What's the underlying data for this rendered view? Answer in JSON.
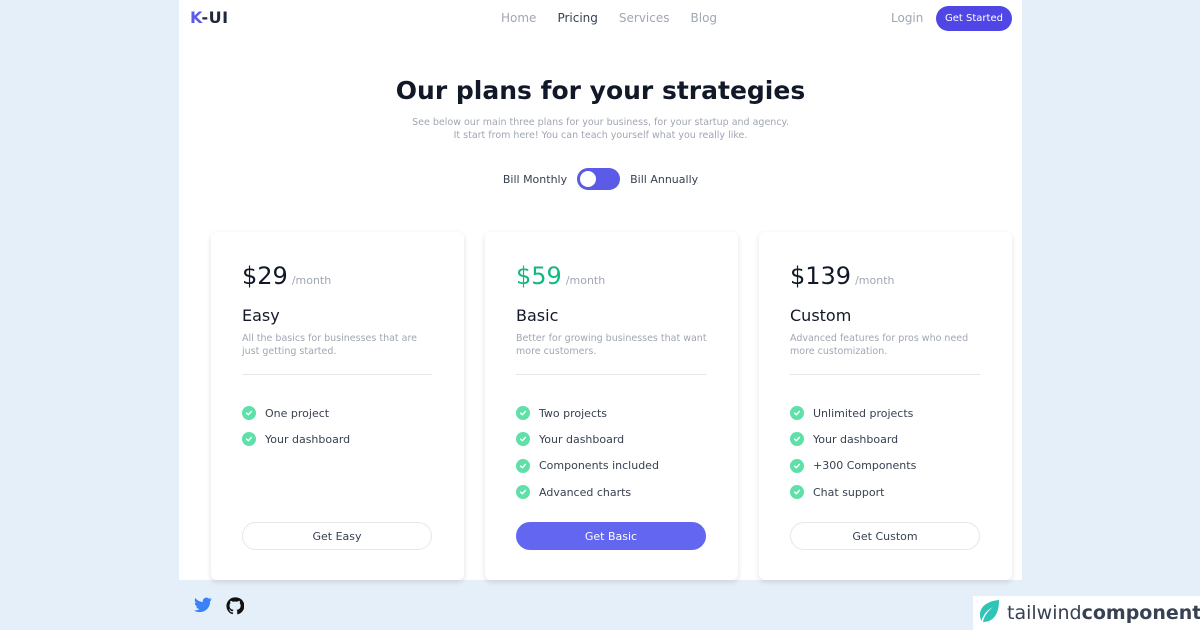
{
  "nav": {
    "logo_k": "K",
    "logo_rest": "-UI",
    "links": [
      {
        "label": "Home",
        "active": false
      },
      {
        "label": "Pricing",
        "active": true
      },
      {
        "label": "Services",
        "active": false
      },
      {
        "label": "Blog",
        "active": false
      }
    ],
    "login": "Login",
    "cta": "Get Started"
  },
  "hero": {
    "title_1": "Our ",
    "title_2": "plans",
    "title_3": " for your ",
    "title_4": "strategies",
    "subtitle_line1": "See below our main three plans for your business, for your startup and agency.",
    "subtitle_line2": "It start from here! You can teach yourself what you really like."
  },
  "billing": {
    "monthly_label": "Bill Monthly",
    "annually_label": "Bill Annually",
    "selected": "monthly"
  },
  "plans": [
    {
      "price": "$29",
      "period": "/month",
      "name": "Easy",
      "description": "All the basics for businesses that are just getting started.",
      "features": [
        "One project",
        "Your dashboard"
      ],
      "cta": "Get Easy",
      "highlighted": false
    },
    {
      "price": "$59",
      "period": "/month",
      "name": "Basic",
      "description": "Better for growing businesses that want more customers.",
      "features": [
        "Two projects",
        "Your dashboard",
        "Components included",
        "Advanced charts"
      ],
      "cta": "Get Basic",
      "highlighted": true
    },
    {
      "price": "$139",
      "period": "/month",
      "name": "Custom",
      "description": "Advanced features for pros who need more customization.",
      "features": [
        "Unlimited projects",
        "Your dashboard",
        "+300 Components",
        "Chat support"
      ],
      "cta": "Get Custom",
      "highlighted": false
    }
  ],
  "footer": {
    "icons": [
      "twitter-icon",
      "github-icon"
    ],
    "brand_light": "tailwind",
    "brand_bold": "components"
  },
  "colors": {
    "accent": "#4f46e5",
    "accent_light": "#6366f1",
    "price_highlight": "#10b981",
    "check": "#5ee0a8",
    "page_bg": "#e5eff9",
    "twitter": "#3b82f6",
    "brand_leaf": "#2ec4b6"
  }
}
